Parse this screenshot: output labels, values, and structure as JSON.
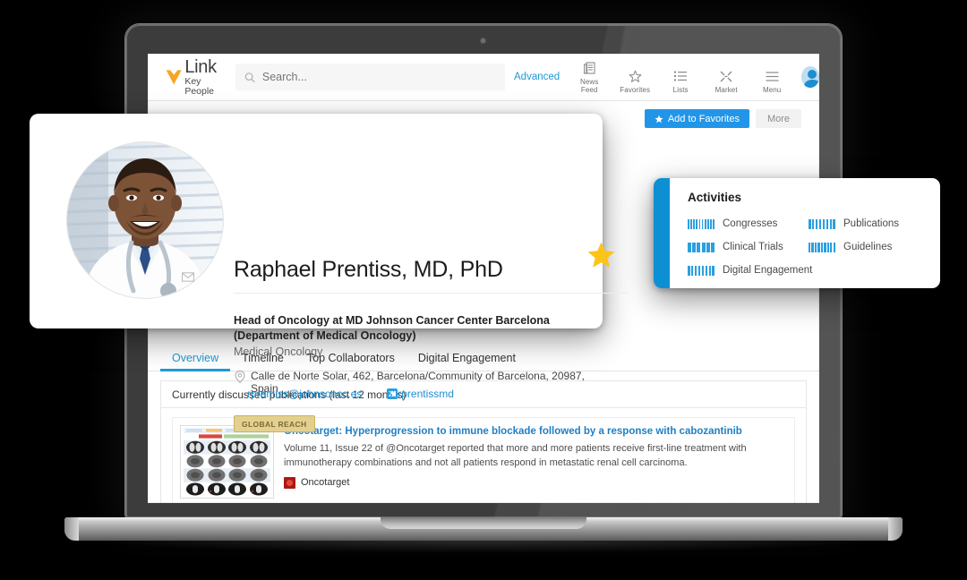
{
  "app": {
    "logo_title": "Link",
    "logo_sub": "Key People",
    "logo_icon": "v-logo-icon"
  },
  "search": {
    "placeholder": "Search...",
    "value": "",
    "icon": "search-icon",
    "advanced_label": "Advanced"
  },
  "nav": [
    {
      "label": "News Feed",
      "icon": "news-feed-icon"
    },
    {
      "label": "Favorites",
      "icon": "star-outline-icon"
    },
    {
      "label": "Lists",
      "icon": "list-icon"
    },
    {
      "label": "Market",
      "icon": "market-icon"
    },
    {
      "label": "Menu",
      "icon": "hamburger-icon"
    }
  ],
  "actions": {
    "favorite_label": "Add to Favorites",
    "favorite_icon": "star-filled-icon",
    "more_label": "More"
  },
  "profile": {
    "name": "Raphael Prentiss, MD, PhD",
    "role": "Head of Oncology at MD Johnson Cancer Center Barcelona (Department of Medical Oncology)",
    "specialty": "Medical Oncology",
    "address": "Calle de Norte Solar, 462, Barcelona/Community of Barcelona, 20987, Spain",
    "email": "rprentiss@johnsoncc.es",
    "twitter": "rprentissmd",
    "badge": "GLOBAL REACH",
    "photo_icon": "doctor-portrait",
    "star_icon": "star-filled-icon",
    "pin_icon": "location-pin-icon",
    "mail_icon": "mail-icon",
    "twitter_icon": "twitter-icon"
  },
  "activities": {
    "title": "Activities",
    "items": [
      {
        "label": "Congresses",
        "bars": 10
      },
      {
        "label": "Publications",
        "bars": 8
      },
      {
        "label": "Clinical Trials",
        "bars": 6
      },
      {
        "label": "Guidelines",
        "bars": 9
      },
      {
        "label": "Digital Engagement",
        "bars": 8
      }
    ]
  },
  "tabs": [
    {
      "label": "Overview",
      "active": true
    },
    {
      "label": "Timeline",
      "active": false
    },
    {
      "label": "Top Collaborators",
      "active": false
    },
    {
      "label": "Digital Engagement",
      "active": false
    }
  ],
  "publications": {
    "section_title": "Currently discussed publications (last 12 months)",
    "items": [
      {
        "title": "Oncotarget: Hyperprogression to immune blockade followed by a response with cabozantinib",
        "description": "Volume 11, Issue 22 of @Oncotarget reported that more and more patients receive first-line treatment with immunotherapy combinations and not all patients respond in metastatic renal cell carcinoma.",
        "source": "Oncotarget",
        "thumbnail_icon": "ct-scan-grid-thumbnail"
      }
    ]
  },
  "colors": {
    "accent_blue": "#2196e8",
    "link_blue": "#1f8fd0",
    "logo_orange": "#f5a623",
    "star_yellow": "#fcc419",
    "badge_tan": "#e3d08e",
    "activities_accent": "#0d8fd4"
  }
}
